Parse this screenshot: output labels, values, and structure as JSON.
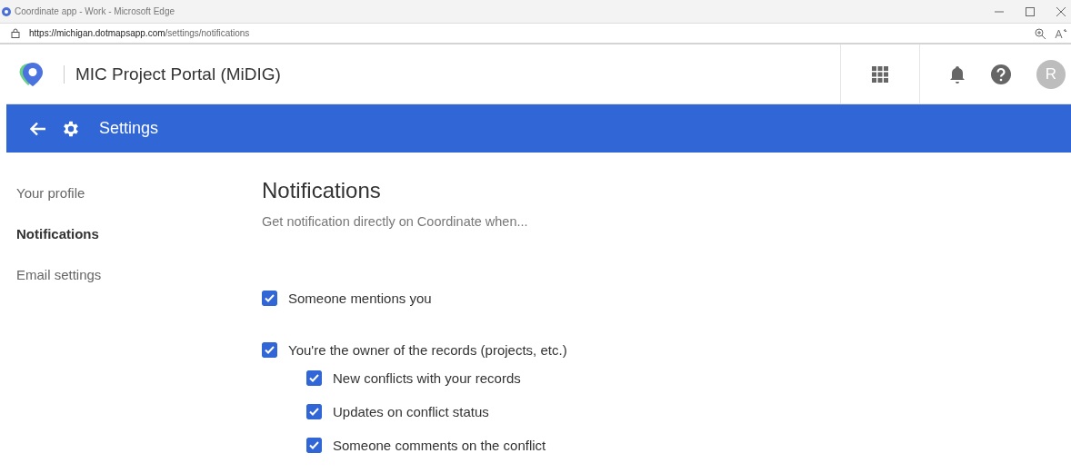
{
  "browser": {
    "title": "Coordinate app - Work - Microsoft Edge",
    "url_host": "https://michigan.dotmapsapp.com",
    "url_path": "/settings/notifications"
  },
  "header": {
    "title": "MIC Project Portal (MiDIG)",
    "avatar": "R"
  },
  "toolbar": {
    "title": "Settings"
  },
  "sidebar": {
    "items": [
      {
        "label": "Your profile",
        "selected": false
      },
      {
        "label": "Notifications",
        "selected": true
      },
      {
        "label": "Email settings",
        "selected": false
      }
    ]
  },
  "content": {
    "title": "Notifications",
    "subtitle": "Get notification directly on Coordinate when...",
    "options": [
      {
        "label": "Someone mentions you",
        "checked": true
      },
      {
        "label": "You're the owner of the records (projects, etc.)",
        "checked": true,
        "children": [
          {
            "label": "New conflicts with your records",
            "checked": true
          },
          {
            "label": "Updates on conflict status",
            "checked": true
          },
          {
            "label": "Someone comments on the conflict",
            "checked": true
          }
        ]
      }
    ]
  }
}
